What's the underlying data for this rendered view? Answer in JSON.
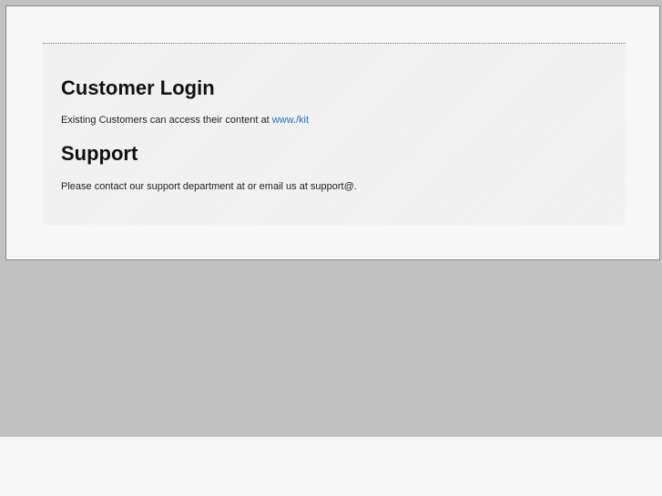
{
  "login": {
    "heading": "Customer Login",
    "text_prefix": "Existing Customers can access their content at ",
    "link_label": "www./kit"
  },
  "support": {
    "heading": "Support",
    "text": "Please contact our support department at or email us at support@."
  },
  "colors": {
    "link": "#1f6fc5",
    "background_gray": "#c1c1c1",
    "panel": "#f7f7f7"
  }
}
